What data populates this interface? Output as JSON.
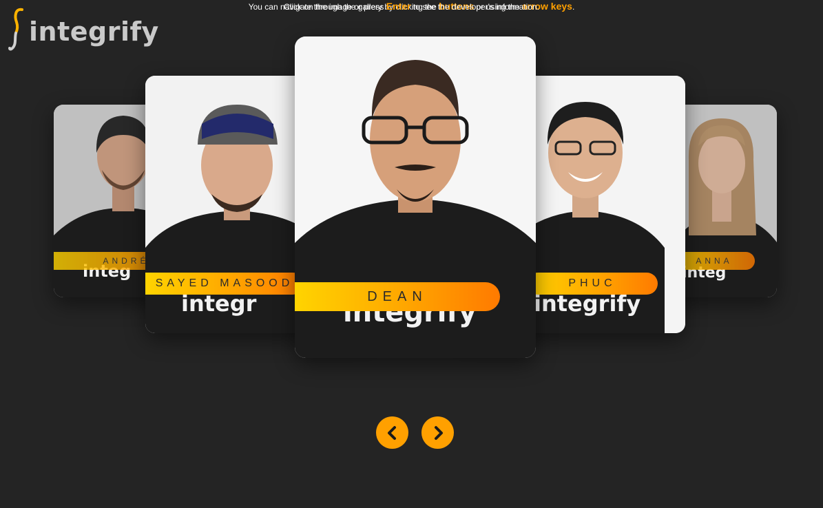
{
  "brand": {
    "logo_text": "integrify",
    "accent_color": "#ffa000",
    "gradient": [
      "#ffd400",
      "#ffa500",
      "#ff7a00"
    ],
    "background": "#242424"
  },
  "gallery": {
    "cards": [
      {
        "id": "andre",
        "name": "ANDRÉ",
        "shirt_text": "integ"
      },
      {
        "id": "sayed",
        "name": "SAYED MASOOD",
        "shirt_text": "integr"
      },
      {
        "id": "dean",
        "name": "DEAN",
        "shirt_text": "integrify",
        "active": true
      },
      {
        "id": "phuc",
        "name": "PHUC",
        "shirt_text": "integrify"
      },
      {
        "id": "anna",
        "name": "ANNA",
        "shirt_text": "integ"
      }
    ]
  },
  "navigation": {
    "prev_icon": "chevron-left-icon",
    "next_icon": "chevron-right-icon"
  },
  "instructions": {
    "line1_pre": "You can navigate through the gallery by clicking the ",
    "line1_hl1": "buttons",
    "line1_mid": " or using the ",
    "line1_hl2": "arrow keys",
    "line1_post": ".",
    "line2_pre": "Click on the image or press ",
    "line2_hl": "Enter",
    "line2_post": " to see the developer's information."
  }
}
